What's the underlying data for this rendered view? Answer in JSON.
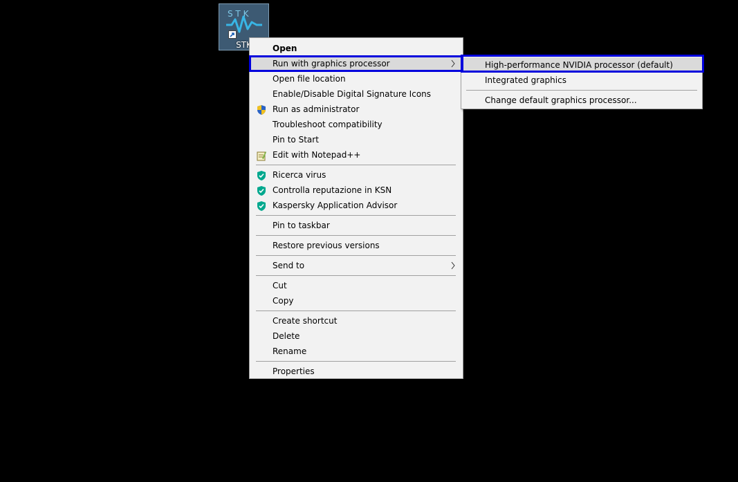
{
  "desktop_icon": {
    "label": "STK",
    "logo_text": "S T K"
  },
  "main_menu": {
    "items": [
      {
        "label": "Open",
        "bold": true
      },
      {
        "label": "Run with graphics processor",
        "submenu": true,
        "highlighted": true
      },
      {
        "label": "Open file location"
      },
      {
        "label": "Enable/Disable Digital Signature Icons"
      },
      {
        "label": "Run as administrator",
        "icon": "uac-shield-icon"
      },
      {
        "label": "Troubleshoot compatibility"
      },
      {
        "label": "Pin to Start"
      },
      {
        "label": "Edit with Notepad++",
        "icon": "notepad-plus-plus-icon"
      },
      {
        "label": "Ricerca virus",
        "icon": "kaspersky-shield-icon"
      },
      {
        "label": "Controlla reputazione in KSN",
        "icon": "kaspersky-shield-icon"
      },
      {
        "label": "Kaspersky Application Advisor",
        "icon": "kaspersky-shield-icon"
      },
      {
        "label": "Pin to taskbar"
      },
      {
        "label": "Restore previous versions"
      },
      {
        "label": "Send to",
        "submenu": true
      },
      {
        "label": "Cut"
      },
      {
        "label": "Copy"
      },
      {
        "label": "Create shortcut"
      },
      {
        "label": "Delete"
      },
      {
        "label": "Rename"
      },
      {
        "label": "Properties"
      }
    ]
  },
  "sub_menu": {
    "items": [
      {
        "label": "High-performance NVIDIA processor (default)",
        "highlighted": true
      },
      {
        "label": "Integrated graphics"
      },
      {
        "label": "Change default graphics processor..."
      }
    ]
  },
  "colors": {
    "highlight_border": "#0000dd",
    "menu_background": "#f2f2f2",
    "kaspersky_green": "#00a88e",
    "desktop_background": "#000000"
  }
}
